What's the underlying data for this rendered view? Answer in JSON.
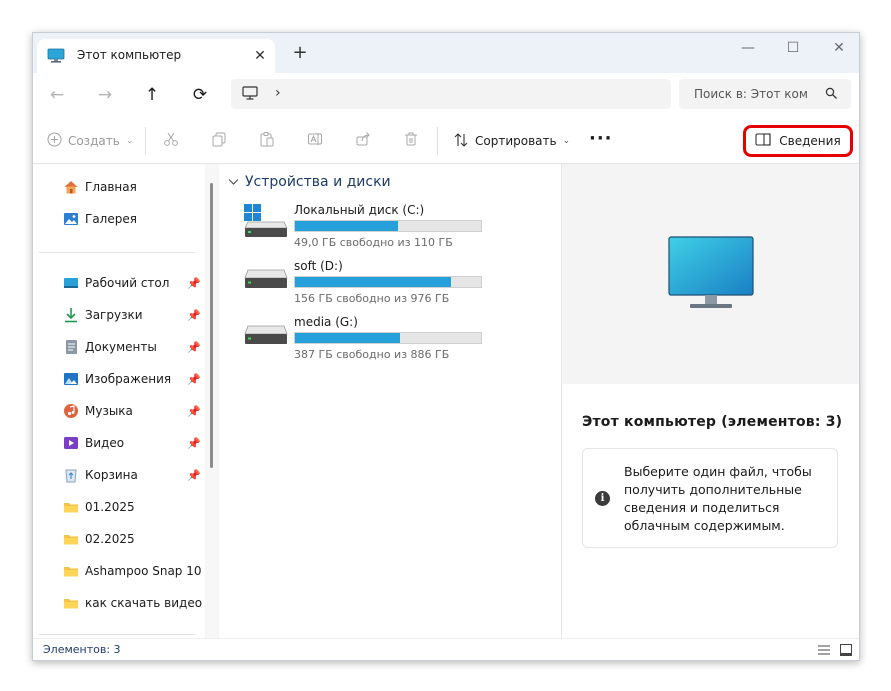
{
  "window": {
    "tab_title": "Этот компьютер",
    "tab_close": "✕",
    "new_tab": "+",
    "minimize": "—",
    "maximize": "☐",
    "close": "✕"
  },
  "navbar": {
    "back": "←",
    "forward": "→",
    "up": "↑",
    "refresh": "⟳",
    "address_chevron": "›",
    "search_placeholder": "Поиск в: Этот ком"
  },
  "toolbar": {
    "create_label": "Создать",
    "sort_label": "Сортировать",
    "more_label": "···",
    "details_label": "Сведения"
  },
  "sidebar": {
    "top_items": [
      {
        "label": "Главная",
        "icon": "home-icon"
      },
      {
        "label": "Галерея",
        "icon": "gallery-icon"
      }
    ],
    "pinned_items": [
      {
        "label": "Рабочий стол",
        "icon": "desktop-folder-icon"
      },
      {
        "label": "Загрузки",
        "icon": "downloads-icon"
      },
      {
        "label": "Документы",
        "icon": "documents-icon"
      },
      {
        "label": "Изображения",
        "icon": "pictures-icon"
      },
      {
        "label": "Музыка",
        "icon": "music-icon"
      },
      {
        "label": "Видео",
        "icon": "videos-icon"
      },
      {
        "label": "Корзина",
        "icon": "recycle-bin-icon"
      }
    ],
    "folders": [
      {
        "label": "01.2025",
        "icon": "folder-icon"
      },
      {
        "label": "02.2025",
        "icon": "folder-icon"
      },
      {
        "label": "Ashampoo Snap 10",
        "icon": "folder-icon"
      },
      {
        "label": "как скачать видео с ru",
        "icon": "folder-icon"
      }
    ]
  },
  "main": {
    "section_title": "Устройства и диски",
    "drives": [
      {
        "name": "Локальный диск (C:)",
        "free_text": "49,0 ГБ свободно из 110 ГБ",
        "used_fraction": 0.555,
        "system": true
      },
      {
        "name": "soft (D:)",
        "free_text": "156 ГБ свободно из 976 ГБ",
        "used_fraction": 0.84,
        "system": false
      },
      {
        "name": "media (G:)",
        "free_text": "387 ГБ свободно из 886 ГБ",
        "used_fraction": 0.563,
        "system": false
      }
    ]
  },
  "details": {
    "title": "Этот компьютер (элементов: 3)",
    "info_icon": "i",
    "info_text": "Выберите один файл, чтобы получить дополнительные сведения и поделиться облачным содержимым."
  },
  "status": {
    "items_count": "Элементов: 3"
  },
  "colors": {
    "accent": "#26a0da",
    "highlight_border": "#e60000",
    "titlebar": "#edf1f8"
  }
}
